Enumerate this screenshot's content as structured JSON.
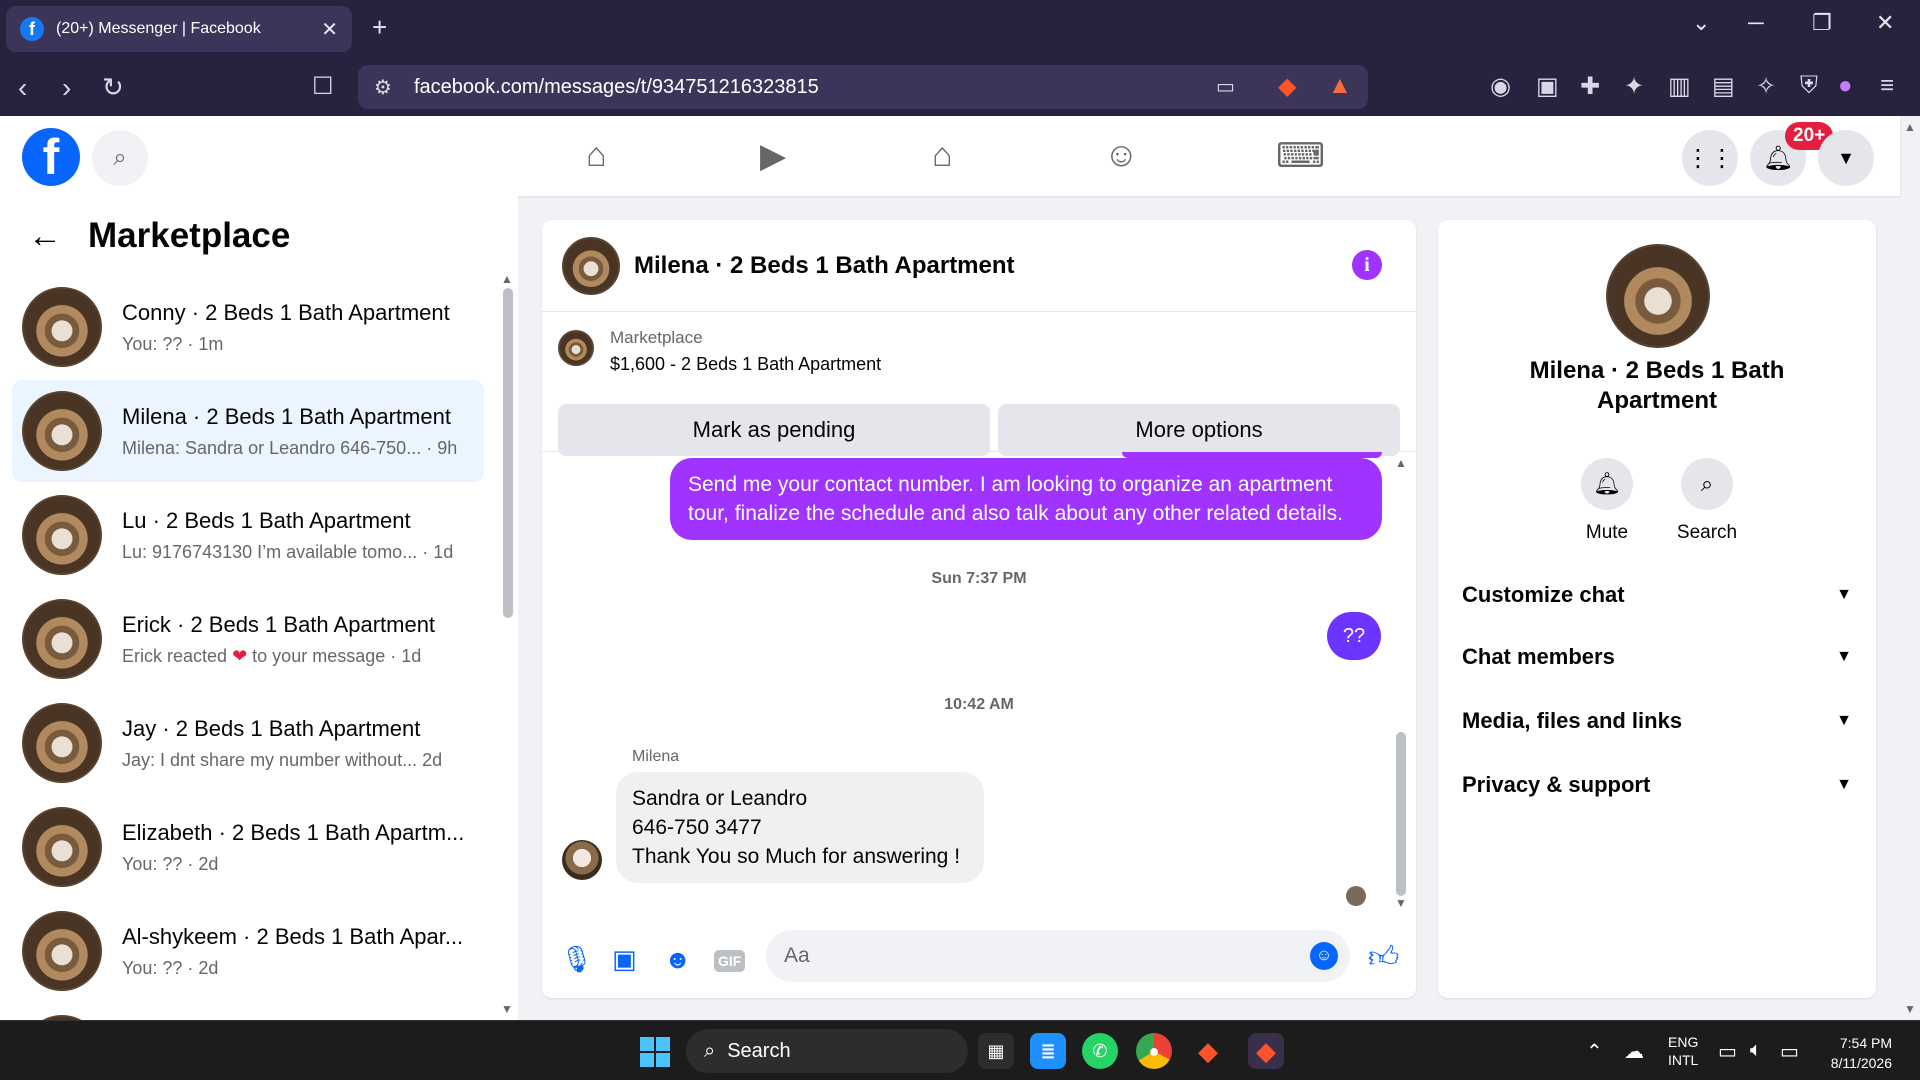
{
  "browser": {
    "tab_title": "(20+) Messenger | Facebook",
    "tab_close": "✕",
    "new_tab": "+",
    "url": "facebook.com/messages/t/934751216323815"
  },
  "fb_header": {
    "logo": "f",
    "notification_badge": "20+"
  },
  "sidebar": {
    "title": "Marketplace",
    "conversations": [
      {
        "name": "Conny · 2 Beds 1 Bath Apartment",
        "preview": "You: ?? · 1m"
      },
      {
        "name": "Milena · 2 Beds 1 Bath Apartment",
        "preview": "Milena: Sandra or Leandro 646-750... · 9h"
      },
      {
        "name": "Lu · 2 Beds 1 Bath Apartment",
        "preview": "Lu: 9176743130 I’m available tomo... · 1d"
      },
      {
        "name": "Erick · 2 Beds 1 Bath Apartment",
        "preview_before": "Erick reacted",
        "preview_heart": "❤",
        "preview_after": "to your message · 1d"
      },
      {
        "name": "Jay · 2 Beds 1 Bath Apartment",
        "preview": "Jay: I dnt share my number without...  2d"
      },
      {
        "name": "Elizabeth · 2 Beds 1 Bath Apartm...",
        "preview": "You: ?? · 2d"
      },
      {
        "name": "Al-shykeem · 2 Beds 1 Bath Apar...",
        "preview": "You: ?? · 2d"
      }
    ]
  },
  "chat": {
    "header_name": "Milena · 2 Beds 1 Bath Apartment",
    "info": "i",
    "marketplace_label": "Marketplace",
    "listing": "$1,600 - 2 Beds 1 Bath Apartment",
    "mark_pending": "Mark as pending",
    "more_options": "More options",
    "outgoing_message": "Send me your contact number. I am looking to organize an apartment tour, finalize the schedule and also talk about any other related details.",
    "timestamp_1": "Sun 7:37 PM",
    "outgoing_short": "??",
    "timestamp_2": "10:42 AM",
    "sender": "Milena",
    "incoming_lines": [
      "Sandra or Leandro",
      "646-750 3477",
      "Thank You so Much for answering !"
    ],
    "input_placeholder": "Aa"
  },
  "right_panel": {
    "name": "Milena · 2 Beds 1 Bath Apartment",
    "mute": "Mute",
    "search": "Search",
    "sections": [
      "Customize chat",
      "Chat members",
      "Media, files and links",
      "Privacy & support"
    ]
  },
  "taskbar": {
    "search": "Search",
    "lang_1": "ENG",
    "lang_2": "INTL",
    "time": "7:54 PM",
    "date": "8/11/2026"
  },
  "colors": {
    "accent_purple": "#a033ff",
    "fb_blue": "#0866ff",
    "badge_red": "#e41e3f"
  }
}
